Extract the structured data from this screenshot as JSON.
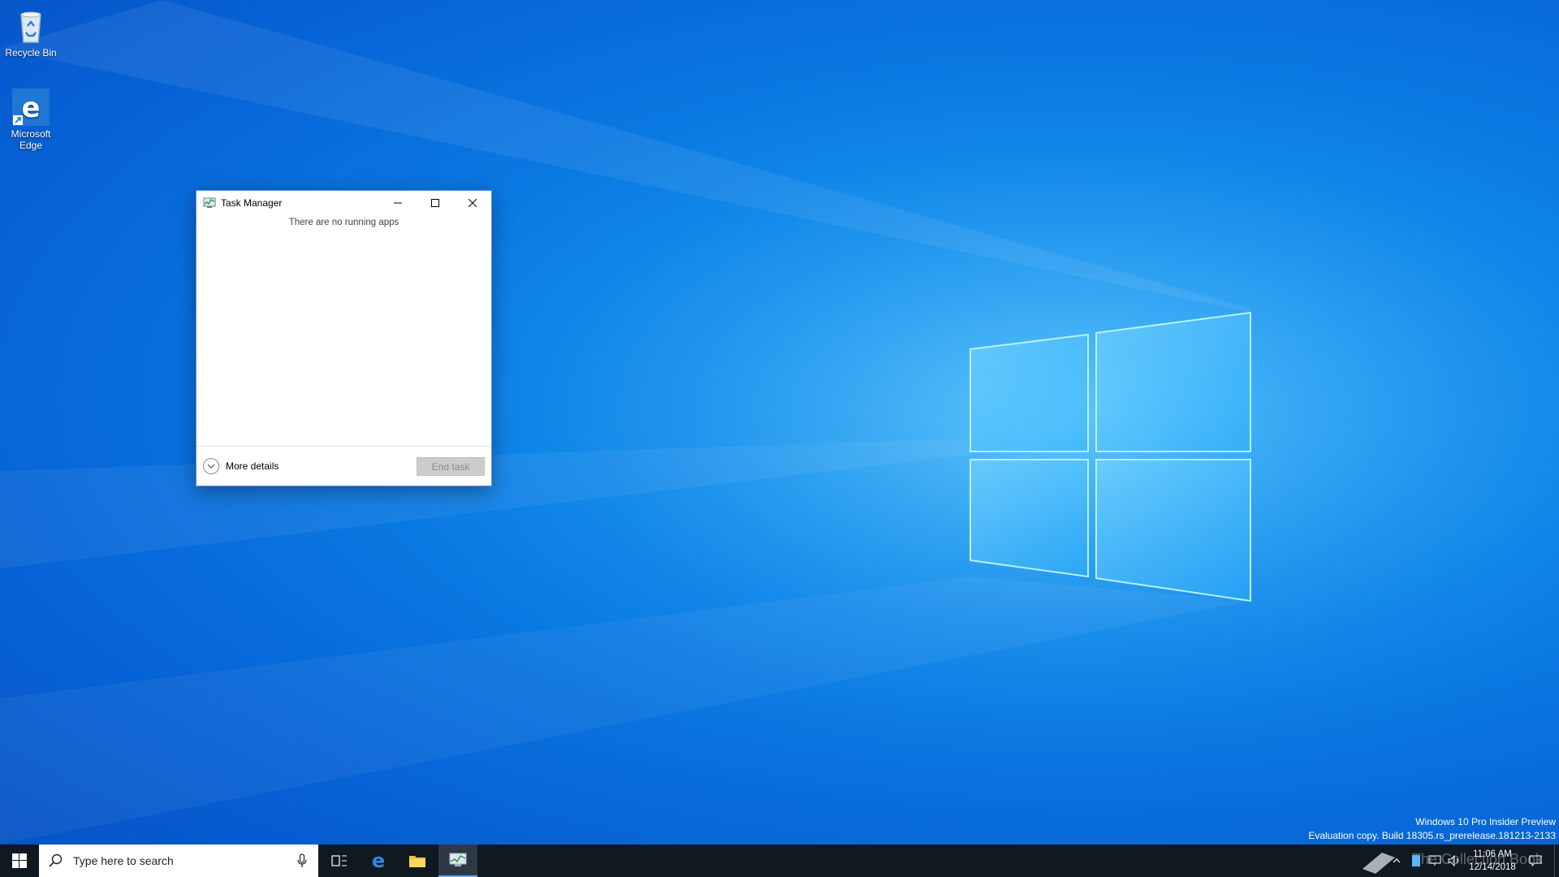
{
  "desktop": {
    "icons": [
      {
        "label": "Recycle Bin"
      },
      {
        "label": "Microsoft\nEdge"
      }
    ]
  },
  "task_manager": {
    "title": "Task Manager",
    "empty_message": "There are no running apps",
    "more_details": "More details",
    "end_task": "End task"
  },
  "watermark": {
    "line1": "Windows 10 Pro Insider Preview",
    "line2": "Evaluation copy. Build 18305.rs_prerelease.181213-2133"
  },
  "taskbar": {
    "search_placeholder": "Type here to search",
    "time": "11:06 AM",
    "date": "12/14/2018",
    "ghost_text": "The Collection Book"
  },
  "colors": {
    "desktop_blue": "#0c84e8",
    "taskbar": "#101820",
    "accent": "#0078d7"
  }
}
